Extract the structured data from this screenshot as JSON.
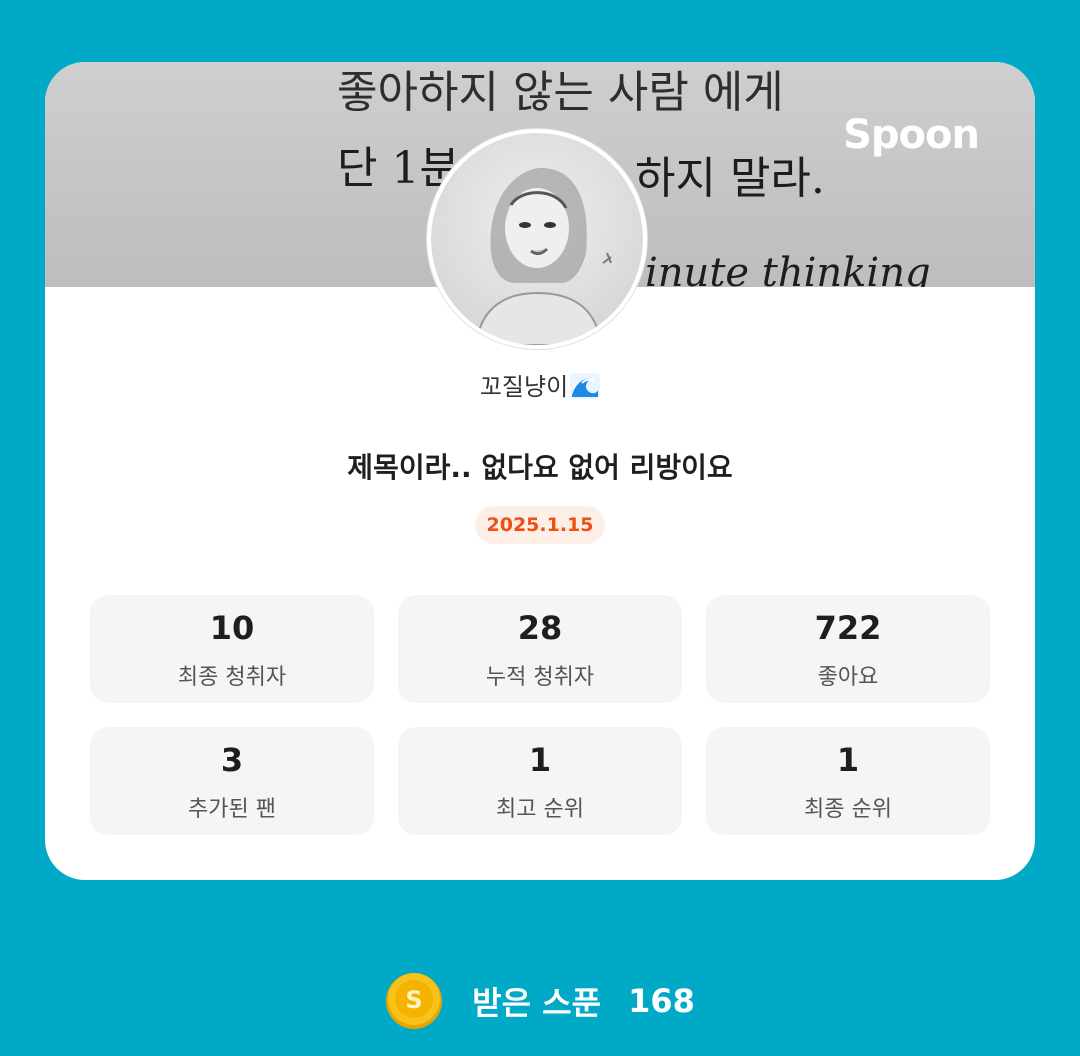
{
  "banner": {
    "lines": [
      "좋아하지 않는 사람 에게",
      "단 1분",
      "하지 말라.",
      "inute thinking"
    ]
  },
  "brand": {
    "name": "Spoon"
  },
  "profile": {
    "username": "꼬질냥이",
    "username_icon": "wave-icon"
  },
  "live": {
    "title": "제목이라.. 없다요 없어 리방이요",
    "date": "2025.1.15"
  },
  "stats": [
    {
      "value": "10",
      "label": "최종 청취자"
    },
    {
      "value": "28",
      "label": "누적 청취자"
    },
    {
      "value": "722",
      "label": "좋아요"
    },
    {
      "value": "3",
      "label": "추가된 팬"
    },
    {
      "value": "1",
      "label": "최고 순위"
    },
    {
      "value": "1",
      "label": "최종 순위"
    }
  ],
  "footer": {
    "label": "받은 스푼",
    "value": "168",
    "icon": "spoon-coin-icon"
  },
  "colors": {
    "background": "#00a9c5",
    "accent": "#f04e12",
    "badge_bg": "#fdeee6",
    "coin": "#f5b800"
  }
}
